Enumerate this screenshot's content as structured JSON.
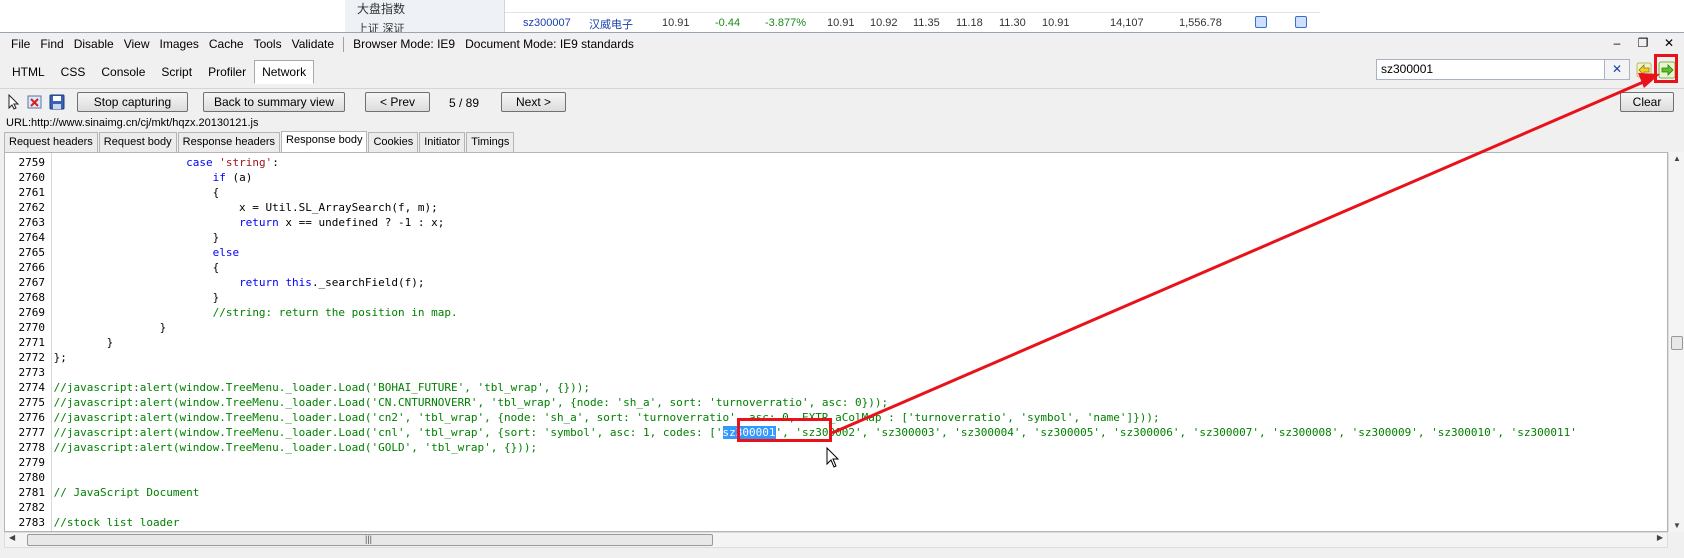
{
  "background_page": {
    "left_label_1": "大盘指数",
    "left_label_2": "上证 深证",
    "row": {
      "code": "sz300007",
      "name": "汉威电子",
      "cells": [
        "10.91",
        "-0.44",
        "-3.877%",
        "10.91",
        "10.92",
        "11.35",
        "11.18",
        "11.30",
        "10.91",
        "14,107",
        "1,556.78"
      ]
    }
  },
  "menu": {
    "items": [
      "File",
      "Find",
      "Disable",
      "View",
      "Images",
      "Cache",
      "Tools",
      "Validate"
    ],
    "browser_mode": "Browser Mode: IE9",
    "document_mode": "Document Mode: IE9 standards",
    "window_controls": [
      "–",
      "❐",
      "✕"
    ]
  },
  "main_tabs": [
    "HTML",
    "CSS",
    "Console",
    "Script",
    "Profiler",
    "Network"
  ],
  "active_main_tab": "Network",
  "search": {
    "value": "sz300001",
    "clear_label": "✕"
  },
  "toolbar": {
    "stop_capturing": "Stop capturing",
    "back_to_summary": "Back to summary view",
    "prev": "< Prev",
    "pager": "5 / 89",
    "next": "Next >",
    "clear": "Clear"
  },
  "url_line": "URL:http://www.sinaimg.cn/cj/mkt/hqzx.20130121.js",
  "detail_tabs": [
    "Request headers",
    "Request body",
    "Response headers",
    "Response body",
    "Cookies",
    "Initiator",
    "Timings"
  ],
  "active_detail_tab": "Response body",
  "code_lines": [
    {
      "n": "2759",
      "parts": [
        {
          "t": "                    "
        },
        {
          "t": "case",
          "c": "kw"
        },
        {
          "t": " "
        },
        {
          "t": "'string'",
          "c": "str"
        },
        {
          "t": ":"
        }
      ]
    },
    {
      "n": "2760",
      "parts": [
        {
          "t": "                        "
        },
        {
          "t": "if",
          "c": "kw"
        },
        {
          "t": " (a)"
        }
      ]
    },
    {
      "n": "2761",
      "parts": [
        {
          "t": "                        {"
        }
      ]
    },
    {
      "n": "2762",
      "parts": [
        {
          "t": "                            x = Util.SL_ArraySearch(f, m);"
        }
      ]
    },
    {
      "n": "2763",
      "parts": [
        {
          "t": "                            "
        },
        {
          "t": "return",
          "c": "kw"
        },
        {
          "t": " x == undefined ? -1 : x;"
        }
      ]
    },
    {
      "n": "2764",
      "parts": [
        {
          "t": "                        }"
        }
      ]
    },
    {
      "n": "2765",
      "parts": [
        {
          "t": "                        "
        },
        {
          "t": "else",
          "c": "kw"
        }
      ]
    },
    {
      "n": "2766",
      "parts": [
        {
          "t": "                        {"
        }
      ]
    },
    {
      "n": "2767",
      "parts": [
        {
          "t": "                            "
        },
        {
          "t": "return",
          "c": "kw"
        },
        {
          "t": " "
        },
        {
          "t": "this",
          "c": "kw"
        },
        {
          "t": "._searchField(f);"
        }
      ]
    },
    {
      "n": "2768",
      "parts": [
        {
          "t": "                        }"
        }
      ]
    },
    {
      "n": "2769",
      "parts": [
        {
          "t": "                        "
        },
        {
          "t": "//string: return the position in map.",
          "c": "cmt"
        }
      ]
    },
    {
      "n": "2770",
      "parts": [
        {
          "t": "                }"
        }
      ]
    },
    {
      "n": "2771",
      "parts": [
        {
          "t": "        }"
        }
      ]
    },
    {
      "n": "2772",
      "parts": [
        {
          "t": "};"
        }
      ]
    },
    {
      "n": "2773",
      "parts": []
    },
    {
      "n": "2774",
      "parts": [
        {
          "t": "//javascript:alert(window.TreeMenu._loader.Load('BOHAI_FUTURE', 'tbl_wrap', {}));",
          "c": "cmt"
        }
      ]
    },
    {
      "n": "2775",
      "parts": [
        {
          "t": "//javascript:alert(window.TreeMenu._loader.Load('CN.CNTURNOVERR', 'tbl_wrap', {node: 'sh_a', sort: 'turnoverratio', asc: 0}));",
          "c": "cmt"
        }
      ]
    },
    {
      "n": "2776",
      "parts": [
        {
          "t": "//javascript:alert(window.TreeMenu._loader.Load('cn2', 'tbl_wrap', {node: 'sh_a', sort: 'turnoverratio', asc: 0, EXTR_aColMap : ['turnoverratio', 'symbol', 'name']}));",
          "c": "cmt"
        }
      ]
    },
    {
      "n": "2777",
      "parts": [
        {
          "t": "//javascript:alert(window.TreeMenu._loader.Load('cnl', 'tbl_wrap', {sort: 'symbol', asc: 1, codes: ['",
          "c": "cmt"
        },
        {
          "t": "sz300001",
          "c": "hl"
        },
        {
          "t": "', 'sz300002', 'sz300003', 'sz300004', 'sz300005', 'sz300006', 'sz300007', 'sz300008', 'sz300009', 'sz300010', 'sz300011'",
          "c": "cmt"
        }
      ]
    },
    {
      "n": "2778",
      "parts": [
        {
          "t": "//javascript:alert(window.TreeMenu._loader.Load('GOLD', 'tbl_wrap', {}));",
          "c": "cmt"
        }
      ]
    },
    {
      "n": "2779",
      "parts": []
    },
    {
      "n": "2780",
      "parts": []
    },
    {
      "n": "2781",
      "parts": [
        {
          "t": "// JavaScript Document",
          "c": "cmt"
        }
      ]
    },
    {
      "n": "2782",
      "parts": []
    },
    {
      "n": "2783",
      "parts": [
        {
          "t": "//stock list loader",
          "c": "cmt"
        }
      ]
    }
  ],
  "scroll_grip": "|||",
  "colors": {
    "annotation_red": "#e8121a",
    "keyword": "#0000ff",
    "string": "#a31515",
    "comment": "#008000",
    "highlight": "#3399ff"
  }
}
